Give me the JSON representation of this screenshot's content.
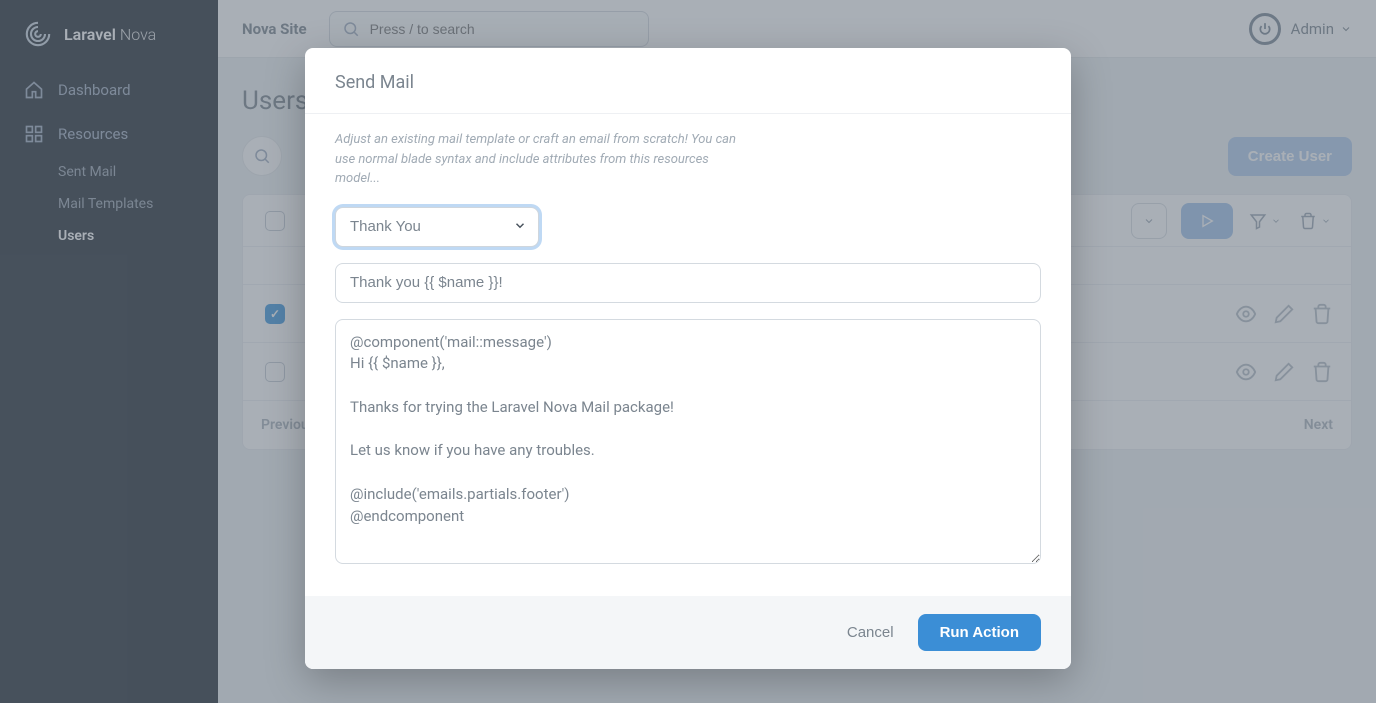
{
  "brand": {
    "name1": "Laravel",
    "name2": "Nova"
  },
  "nav": {
    "dashboard": "Dashboard",
    "resources": "Resources",
    "sent_mail": "Sent Mail",
    "mail_templates": "Mail Templates",
    "users": "Users"
  },
  "topbar": {
    "site": "Nova Site",
    "search_placeholder": "Press / to search",
    "admin": "Admin"
  },
  "page": {
    "title": "Users",
    "create_button": "Create User",
    "previous": "Previous",
    "next": "Next"
  },
  "modal": {
    "title": "Send Mail",
    "help": "Adjust an existing mail template or craft an email from scratch! You can use normal blade syntax and include attributes from this resources model...",
    "template_selected": "Thank You",
    "subject": "Thank you {{ $name }}!",
    "body": "@component('mail::message')\nHi {{ $name }},\n\nThanks for trying the Laravel Nova Mail package!\n\nLet us know if you have any troubles.\n\n@include('emails.partials.footer')\n@endcomponent",
    "cancel": "Cancel",
    "run": "Run Action"
  }
}
